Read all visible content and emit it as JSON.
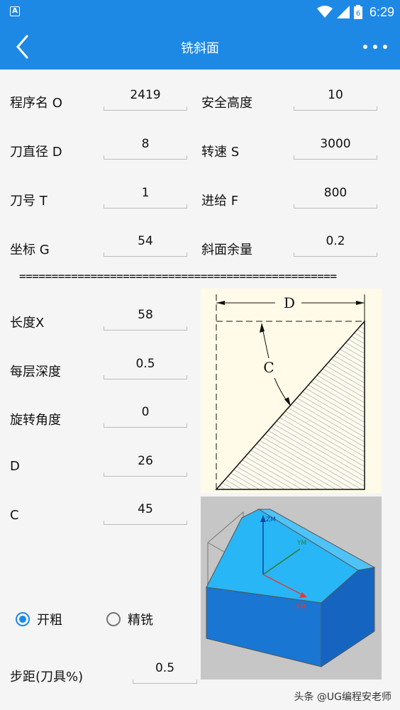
{
  "status": {
    "time": "6:29",
    "battery": "6",
    "app_icon": "A"
  },
  "appbar": {
    "title": "铣斜面"
  },
  "top_params": [
    {
      "label": "程序名 O",
      "value": "2419"
    },
    {
      "label": "安全高度",
      "value": "10"
    },
    {
      "label": "刀直径 D",
      "value": "8"
    },
    {
      "label": "转速 S",
      "value": "3000"
    },
    {
      "label": "刀号 T",
      "value": "1"
    },
    {
      "label": "进给 F",
      "value": "800"
    },
    {
      "label": "坐标 G",
      "value": "54"
    },
    {
      "label": "斜面余量",
      "value": "0.2"
    }
  ],
  "divider": "=================================================",
  "left_params": [
    {
      "label": "长度X",
      "value": "58"
    },
    {
      "label": "每层深度",
      "value": "0.5"
    },
    {
      "label": "旋转角度",
      "value": "0"
    },
    {
      "label": "D",
      "value": "26"
    },
    {
      "label": "C",
      "value": "45"
    }
  ],
  "diagram": {
    "dim_d": "D",
    "dim_c": "C"
  },
  "model3d": {
    "zm": "ZM",
    "ym": "YM",
    "xm": "XM"
  },
  "mode": {
    "rough": "开粗",
    "finish": "精铣",
    "selected": "rough"
  },
  "step": {
    "label": "步距(刀具%)",
    "value": "0.5"
  },
  "watermark": "头条 @UG编程安老师",
  "colors": {
    "primary": "#1e88e5",
    "model_light": "#29b6f6",
    "model_dark": "#1976d2"
  }
}
